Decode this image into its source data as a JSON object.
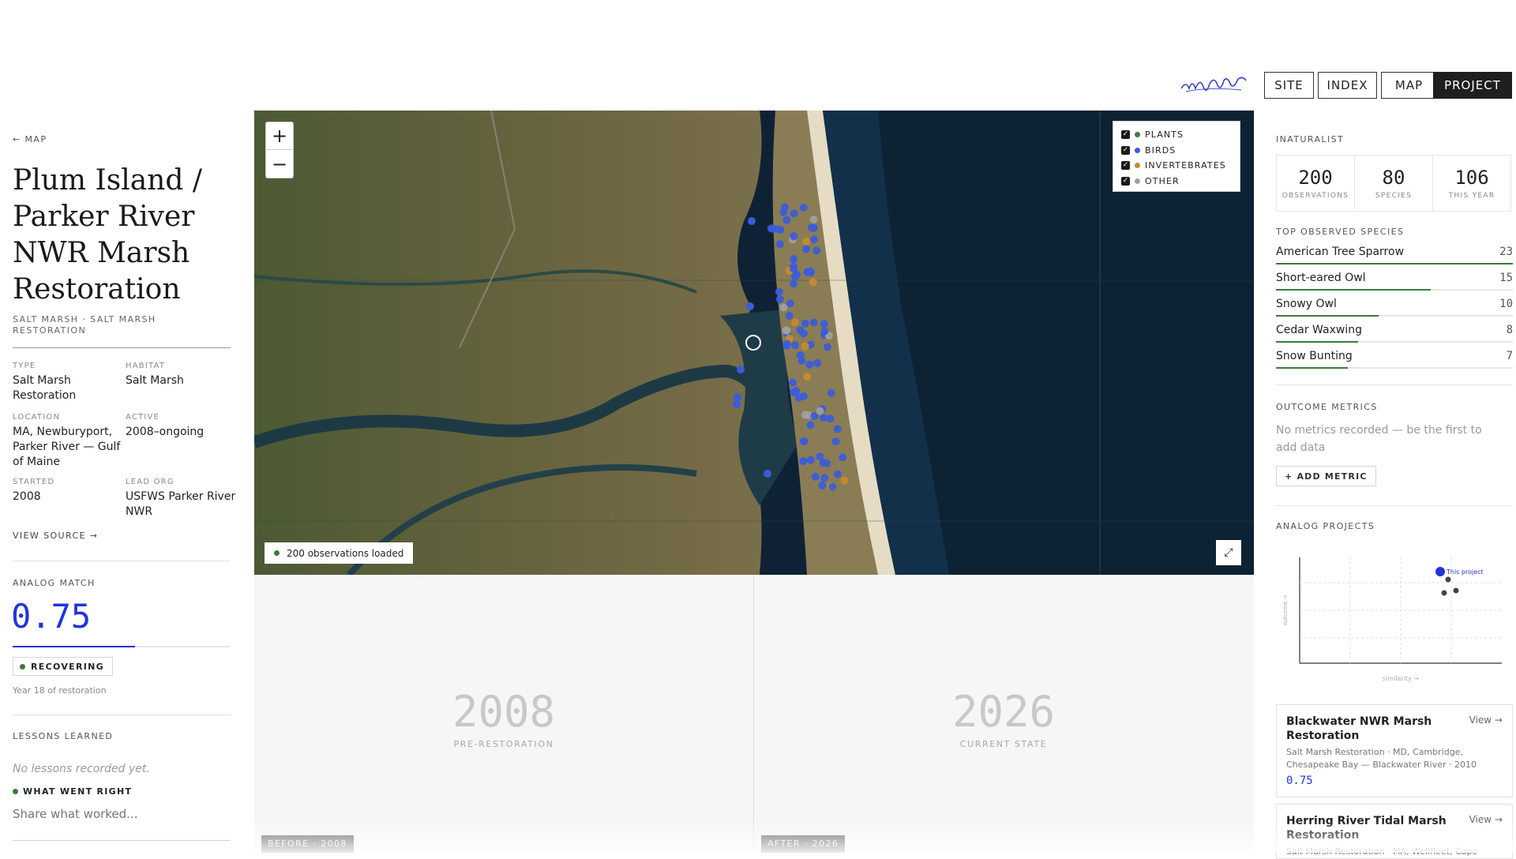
{
  "nav": {
    "brand": "analog",
    "items": [
      {
        "label": "SITE",
        "active": false
      },
      {
        "label": "INDEX",
        "active": false
      },
      {
        "label": "MAP",
        "active": false
      },
      {
        "label": "PROJECT",
        "active": true
      }
    ]
  },
  "left": {
    "back_label": "← MAP",
    "title": "Plum Island / Parker River NWR Marsh Restoration",
    "subtitle": "SALT MARSH · SALT MARSH RESTORATION",
    "meta": [
      {
        "label": "TYPE",
        "value": "Salt Marsh Restoration"
      },
      {
        "label": "HABITAT",
        "value": "Salt Marsh"
      },
      {
        "label": "LOCATION",
        "value": "MA, Newburyport, Parker River — Gulf of Maine"
      },
      {
        "label": "ACTIVE",
        "value": "2008–ongoing"
      },
      {
        "label": "STARTED",
        "value": "2008"
      },
      {
        "label": "LEAD ORG",
        "value": "USFWS Parker River NWR"
      }
    ],
    "view_source": "VIEW SOURCE →",
    "analog_match_label": "ANALOG MATCH",
    "analog_match_value": "0.75",
    "analog_match_fraction": 0.75,
    "status_badge": "RECOVERING",
    "year_note": "Year 18 of restoration",
    "lessons_label": "LESSONS LEARNED",
    "lessons_empty": "No lessons recorded yet.",
    "what_went_right_label": "WHAT WENT RIGHT",
    "share_placeholder": "Share what worked..."
  },
  "map": {
    "zoom_in": "+",
    "zoom_out": "−",
    "legend": [
      {
        "label": "PLANTS",
        "color": "#3f7a3f",
        "checked": true
      },
      {
        "label": "BIRDS",
        "color": "#3b5bdb",
        "checked": true
      },
      {
        "label": "INVERTEBRATES",
        "color": "#c98a2e",
        "checked": true
      },
      {
        "label": "OTHER",
        "color": "#a0a0a0",
        "checked": true
      }
    ],
    "observations_loaded": "200 observations loaded",
    "expand_icon": "expand-icon"
  },
  "compare": {
    "before": {
      "year": "2008",
      "state": "PRE-RESTORATION",
      "badge": "BEFORE · 2008"
    },
    "after": {
      "year": "2026",
      "state": "CURRENT STATE",
      "badge": "AFTER · 2026"
    }
  },
  "right": {
    "inat_label": "INATURALIST",
    "stats": [
      {
        "value": "200",
        "label": "OBSERVATIONS"
      },
      {
        "value": "80",
        "label": "SPECIES"
      },
      {
        "value": "106",
        "label": "THIS YEAR"
      }
    ],
    "top_species_label": "TOP OBSERVED SPECIES",
    "species": [
      {
        "name": "American Tree Sparrow",
        "count": "23",
        "value": 23
      },
      {
        "name": "Short-eared Owl",
        "count": "15",
        "value": 15
      },
      {
        "name": "Snowy Owl",
        "count": "10",
        "value": 10
      },
      {
        "name": "Cedar Waxwing",
        "count": "8",
        "value": 8
      },
      {
        "name": "Snow Bunting",
        "count": "7",
        "value": 7
      }
    ],
    "outcome_label": "OUTCOME METRICS",
    "outcome_empty": "No metrics recorded — be the first to add data",
    "add_metric": "+ ADD METRIC",
    "analog_projects_label": "ANALOG PROJECTS",
    "scatter": {
      "this_project_label": "This project",
      "x_label": "similarity →",
      "y_label": "outcome →"
    },
    "projects": [
      {
        "title": "Blackwater NWR Marsh Restoration",
        "view": "View →",
        "detail": "Salt Marsh Restoration · MD, Cambridge, Chesapeake Bay — Blackwater River · 2010",
        "score": "0.75"
      },
      {
        "title": "Herring River Tidal Marsh Restoration",
        "view": "View →",
        "detail": "Salt Marsh Restoration · MA, Wellfleet, Cape"
      }
    ]
  }
}
